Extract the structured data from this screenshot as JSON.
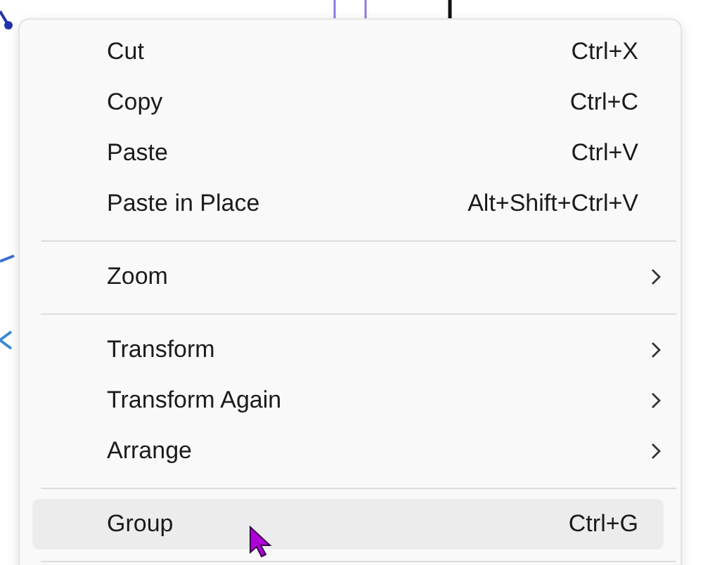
{
  "context_menu": {
    "items": [
      {
        "kind": "command",
        "label": "Cut",
        "shortcut": "Ctrl+X",
        "selected": false
      },
      {
        "kind": "command",
        "label": "Copy",
        "shortcut": "Ctrl+C",
        "selected": false
      },
      {
        "kind": "command",
        "label": "Paste",
        "shortcut": "Ctrl+V",
        "selected": false
      },
      {
        "kind": "command",
        "label": "Paste in Place",
        "shortcut": "Alt+Shift+Ctrl+V",
        "selected": false
      },
      {
        "kind": "separator"
      },
      {
        "kind": "submenu",
        "label": "Zoom",
        "selected": false
      },
      {
        "kind": "separator"
      },
      {
        "kind": "submenu",
        "label": "Transform",
        "selected": false
      },
      {
        "kind": "submenu",
        "label": "Transform Again",
        "selected": false
      },
      {
        "kind": "submenu",
        "label": "Arrange",
        "selected": false
      },
      {
        "kind": "separator"
      },
      {
        "kind": "command",
        "label": "Group",
        "shortcut": "Ctrl+G",
        "selected": true
      },
      {
        "kind": "separator"
      }
    ]
  }
}
